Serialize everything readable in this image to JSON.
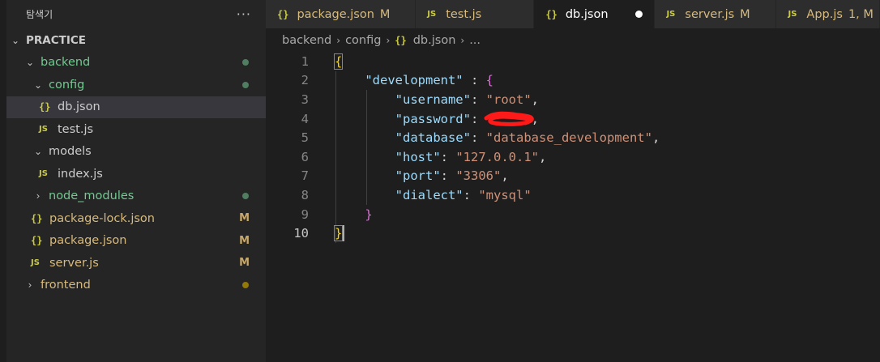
{
  "explorer": {
    "title": "탐색기",
    "more": "···"
  },
  "tree": {
    "root": "PRACTICE",
    "items": [
      {
        "label": "backend",
        "status": "●"
      },
      {
        "label": "config",
        "status": "●"
      },
      {
        "label": "db.json"
      },
      {
        "label": "test.js"
      },
      {
        "label": "models"
      },
      {
        "label": "index.js"
      },
      {
        "label": "node_modules",
        "status": "●"
      },
      {
        "label": "package-lock.json",
        "badge": "M"
      },
      {
        "label": "package.json",
        "badge": "M"
      },
      {
        "label": "server.js",
        "badge": "M"
      },
      {
        "label": "frontend",
        "status": "●"
      }
    ]
  },
  "icons": {
    "json": "{}",
    "js": "JS",
    "chevron_down": "⌄",
    "chevron_right": "›"
  },
  "tabs": [
    {
      "label": "package.json",
      "badge": "M"
    },
    {
      "label": "test.js"
    },
    {
      "label": "db.json"
    },
    {
      "label": "server.js",
      "badge": "M"
    },
    {
      "label": "App.js",
      "badge": "1, M"
    }
  ],
  "breadcrumb": {
    "parts": [
      "backend",
      "config",
      "db.json",
      "..."
    ]
  },
  "editor": {
    "line_numbers": [
      "1",
      "2",
      "3",
      "4",
      "5",
      "6",
      "7",
      "8",
      "9",
      "10"
    ],
    "code": {
      "open_brace": "{",
      "development_key": "\"development\"",
      "colon_brace": " : ",
      "inner_open": "{",
      "username_key": "\"username\"",
      "username_val": "\"root\"",
      "password_key": "\"password\"",
      "database_key": "\"database\"",
      "database_val": "\"database_development\"",
      "host_key": "\"host\"",
      "host_val": "\"127.0.0.1\"",
      "port_key": "\"port\"",
      "port_val": "\"3306\"",
      "dialect_key": "\"dialect\"",
      "dialect_val": "\"mysql\"",
      "inner_close": "}",
      "close_brace": "}",
      "colon": ": ",
      "comma": ","
    }
  },
  "colors": {
    "json_key": "#9cdcfe",
    "json_string": "#ce9178",
    "bracket_level1": "#ffd700",
    "bracket_level2": "#da70d6",
    "git_modified": "#d7ba7d",
    "git_untracked": "#73c991"
  }
}
